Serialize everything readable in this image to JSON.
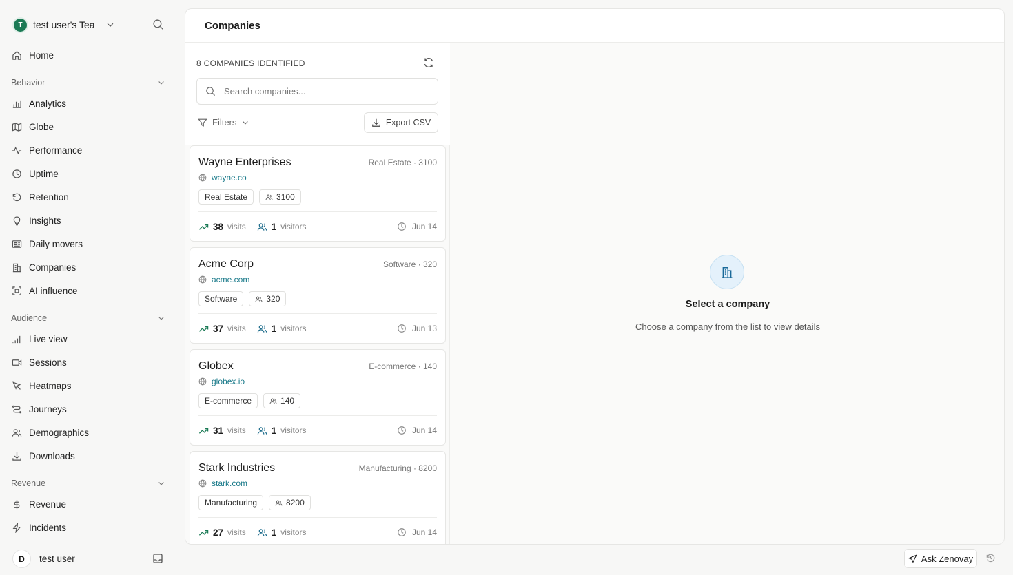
{
  "team": {
    "initial": "T",
    "name": "test user's Tea"
  },
  "nav": {
    "home": "Home",
    "sections": {
      "behavior": "Behavior",
      "audience": "Audience",
      "revenue": "Revenue"
    },
    "behavior": [
      "Analytics",
      "Globe",
      "Performance",
      "Uptime",
      "Retention",
      "Insights",
      "Daily movers",
      "Companies",
      "AI influence"
    ],
    "audience": [
      "Live view",
      "Sessions",
      "Heatmaps",
      "Journeys",
      "Demographics",
      "Downloads"
    ],
    "revenue": [
      "Revenue",
      "Incidents"
    ]
  },
  "user": {
    "initial": "D",
    "name": "test user"
  },
  "page": {
    "title": "Companies"
  },
  "list": {
    "count_label": "8 COMPANIES IDENTIFIED",
    "search_placeholder": "Search companies...",
    "filters_label": "Filters",
    "export_label": "Export CSV",
    "visits_unit": "visits",
    "visitors_unit": "visitors"
  },
  "companies": [
    {
      "name": "Wayne Enterprises",
      "meta": "Real Estate · 3100",
      "domain": "wayne.co",
      "industry": "Real Estate",
      "employees": "3100",
      "visits": "38",
      "visitors": "1",
      "date": "Jun 14"
    },
    {
      "name": "Acme Corp",
      "meta": "Software · 320",
      "domain": "acme.com",
      "industry": "Software",
      "employees": "320",
      "visits": "37",
      "visitors": "1",
      "date": "Jun 13"
    },
    {
      "name": "Globex",
      "meta": "E-commerce · 140",
      "domain": "globex.io",
      "industry": "E-commerce",
      "employees": "140",
      "visits": "31",
      "visitors": "1",
      "date": "Jun 14"
    },
    {
      "name": "Stark Industries",
      "meta": "Manufacturing · 8200",
      "domain": "stark.com",
      "industry": "Manufacturing",
      "employees": "8200",
      "visits": "27",
      "visitors": "1",
      "date": "Jun 14"
    }
  ],
  "detail": {
    "title": "Select a company",
    "subtitle": "Choose a company from the list to view details"
  },
  "assistant": {
    "label": "Ask Zenovay"
  }
}
